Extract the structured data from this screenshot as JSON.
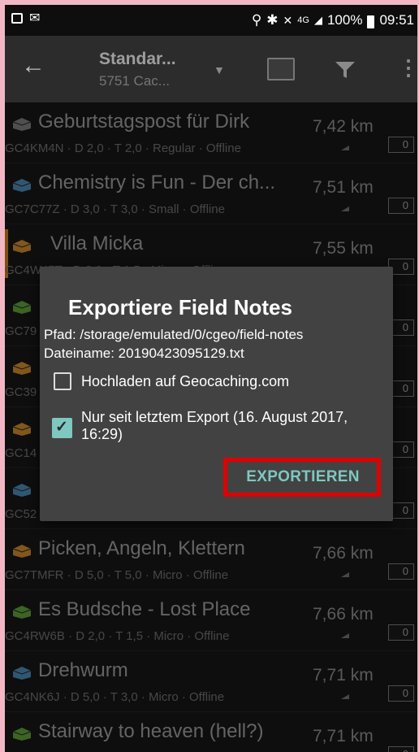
{
  "status_bar": {
    "network": "4G",
    "battery": "100%",
    "time": "09:51"
  },
  "toolbar": {
    "title": "Standar...",
    "subtitle": "5751 Cac..."
  },
  "caches": [
    {
      "name": "Geburtstagspost für Dirk",
      "meta": "GC4KM4N · D 2,0 · T 2,0 · Regular · Offline",
      "distance": "7,42 km",
      "count": "0",
      "icon": "envelope-icon"
    },
    {
      "name": "Chemistry is Fun - Der ch...",
      "meta": "GC7C77Z · D 3,0 · T 3,0 · Small · Offline",
      "distance": "7,51 km",
      "count": "0",
      "icon": "blue-box-icon"
    },
    {
      "name": "Villa Micka",
      "meta": "GC4W47T · D 2,0 · T 1,5 · Micro · Offline",
      "distance": "7,55 km",
      "count": "0",
      "icon": "event-icon"
    },
    {
      "name": "",
      "meta": "GC79",
      "distance": "",
      "count": "0",
      "icon": "green-box-icon"
    },
    {
      "name": "",
      "meta": "GC39",
      "distance": "",
      "count": "0",
      "icon": "orange-box-icon"
    },
    {
      "name": "",
      "meta": "GC14",
      "distance": "",
      "count": "0",
      "icon": "orange-box-icon"
    },
    {
      "name": "",
      "meta": "GC52",
      "distance": "",
      "count": "0",
      "icon": "blue-box-icon"
    },
    {
      "name": "Picken, Angeln, Klettern",
      "meta": "GC7TMFR · D 5,0 · T 5,0 · Micro · Offline",
      "distance": "7,66 km",
      "count": "0",
      "icon": "orange-box-icon"
    },
    {
      "name": "Es Budsche - Lost Place",
      "meta": "GC4RW6B · D 2,0 · T 1,5 · Micro · Offline",
      "distance": "7,66 km",
      "count": "0",
      "icon": "green-box-icon"
    },
    {
      "name": "Drehwurm",
      "meta": "GC4NK6J · D 5,0 · T 3,0 · Micro · Offline",
      "distance": "7,71 km",
      "count": "0",
      "icon": "blue-box-icon"
    },
    {
      "name": "Stairway to heaven (hell?)",
      "meta": "",
      "distance": "7,71 km",
      "count": "0",
      "icon": "green-box-icon"
    }
  ],
  "dialog": {
    "title": "Exportiere Field Notes",
    "path": "Pfad: /storage/emulated/0/cgeo/field-notes",
    "filename": "Dateiname: 20190423095129.txt",
    "checkbox_upload": {
      "label": "Hochladen auf Geocaching.com",
      "checked": false
    },
    "checkbox_since_last": {
      "label": "Nur seit letztem Export (16. August 2017, 16:29)",
      "checked": true
    },
    "export_button": "EXPORTIEREN"
  },
  "colors": {
    "accent": "#7ec8c0",
    "highlight": "#e00000",
    "frame": "#f2b7c5"
  }
}
